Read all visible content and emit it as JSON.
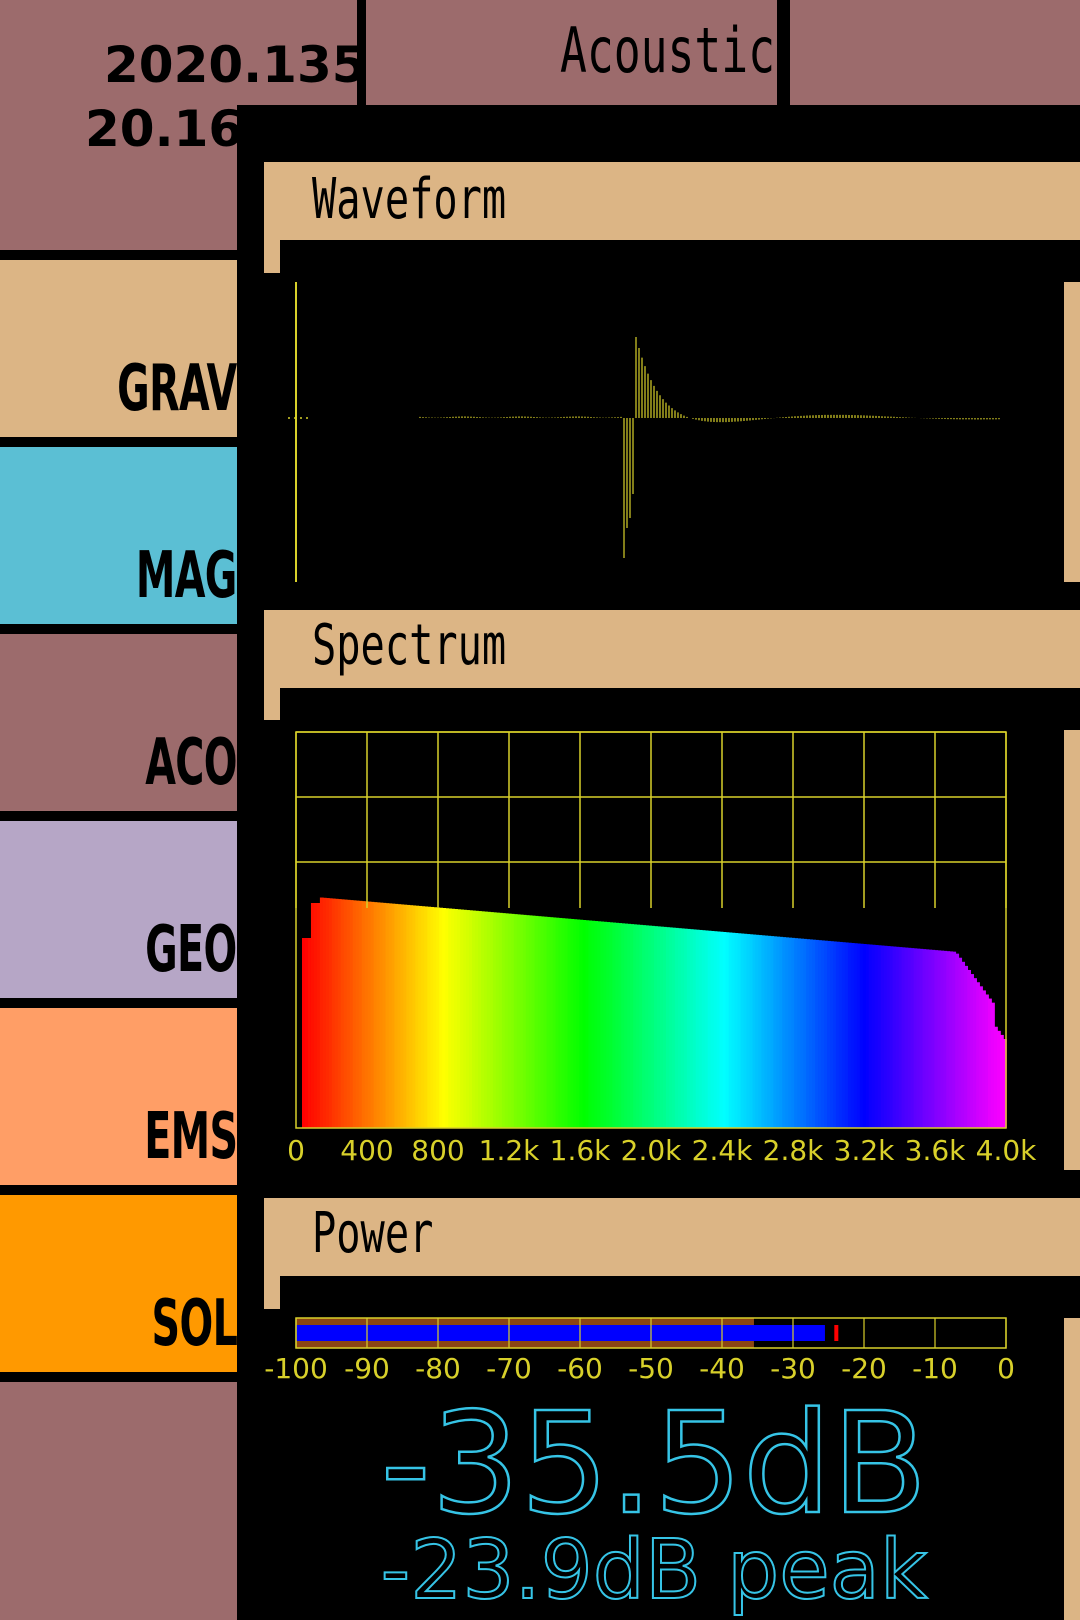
{
  "header": {
    "date_line1": "2020.135",
    "date_line2": "20.16",
    "title": "Acoustic"
  },
  "sidebar": {
    "items": [
      {
        "label": "GRAV",
        "color": "#dcb585"
      },
      {
        "label": "MAG",
        "color": "#5bbfd4"
      },
      {
        "label": "ACO",
        "color": "#9c6b6c"
      },
      {
        "label": "GEO",
        "color": "#b6a6c6"
      },
      {
        "label": "EMS",
        "color": "#ff9e66"
      },
      {
        "label": "SOL",
        "color": "#ff9900"
      }
    ]
  },
  "waveform": {
    "title": "Waveform"
  },
  "spectrum": {
    "title": "Spectrum",
    "x_ticks": [
      "0",
      "400",
      "800",
      "1.2k",
      "1.6k",
      "2.0k",
      "2.4k",
      "2.8k",
      "3.2k",
      "3.6k",
      "4.0k"
    ]
  },
  "power": {
    "title": "Power",
    "ticks": [
      "-100",
      "-90",
      "-80",
      "-70",
      "-60",
      "-50",
      "-40",
      "-30",
      "-20",
      "-10",
      "0"
    ],
    "scale_min_db": -100,
    "scale_max_db": 0,
    "level_db": -35.5,
    "bar_db": -25.5,
    "peak_db": -23.9,
    "level_text": "-35.5dB",
    "peak_text": "-23.9dB peak"
  },
  "colors": {
    "accent_tan": "#dcb585",
    "frame_mauve": "#9c6b6c",
    "grid_yellow": "#d8d02a",
    "readout_cyan": "#36c4e6",
    "bar_blue": "#0000ff",
    "bar_brown": "#8b4513",
    "peak_red": "#ff0000"
  }
}
